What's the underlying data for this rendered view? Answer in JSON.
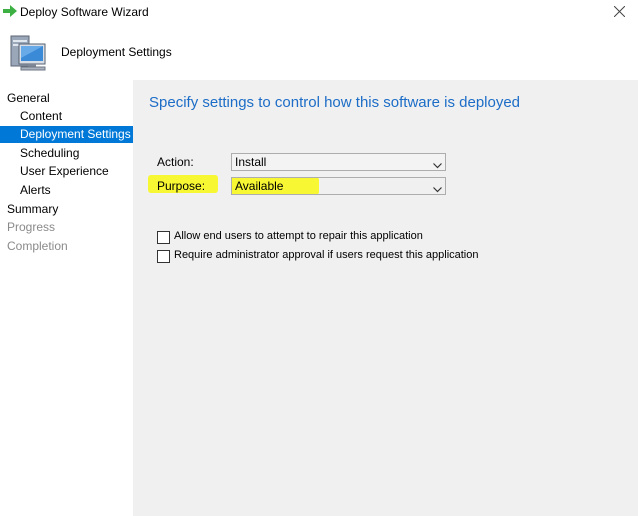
{
  "window": {
    "title": "Deploy Software Wizard",
    "close_icon": "close-icon",
    "title_icon": "green-arrow-icon"
  },
  "header": {
    "title": "Deployment Settings",
    "icon": "computer-icon"
  },
  "nav": {
    "items": [
      {
        "label": "General",
        "state": "normal"
      },
      {
        "label": "Content",
        "state": "normal"
      },
      {
        "label": "Deployment Settings",
        "state": "selected"
      },
      {
        "label": "Scheduling",
        "state": "normal"
      },
      {
        "label": "User Experience",
        "state": "normal"
      },
      {
        "label": "Alerts",
        "state": "normal"
      },
      {
        "label": "Summary",
        "state": "normal"
      },
      {
        "label": "Progress",
        "state": "disabled"
      },
      {
        "label": "Completion",
        "state": "disabled"
      }
    ]
  },
  "main": {
    "heading": "Specify settings to control how this software is deployed",
    "action": {
      "label": "Action:",
      "value": "Install"
    },
    "purpose": {
      "label": "Purpose:",
      "value": "Available"
    },
    "options": [
      {
        "label": "Allow end users to attempt to repair this application",
        "checked": false
      },
      {
        "label": "Require administrator approval if users request this application",
        "checked": false
      }
    ]
  },
  "colors": {
    "accent": "#0078d7",
    "heading": "#1c6dc7",
    "highlight": "#f8f813",
    "panel_bg": "#f0f0f0"
  }
}
